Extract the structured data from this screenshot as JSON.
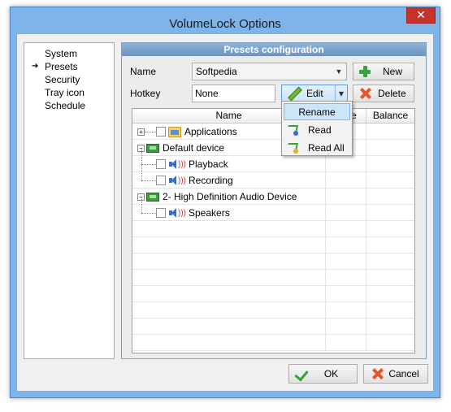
{
  "window": {
    "title": "VolumeLock Options",
    "close_label": "✕"
  },
  "nav": {
    "items": [
      {
        "label": "System",
        "selected": false
      },
      {
        "label": "Presets",
        "selected": true
      },
      {
        "label": "Security",
        "selected": false
      },
      {
        "label": "Tray icon",
        "selected": false
      },
      {
        "label": "Schedule",
        "selected": false
      }
    ]
  },
  "presets": {
    "header": "Presets configuration",
    "name_label": "Name",
    "name_value": "Softpedia",
    "hotkey_label": "Hotkey",
    "hotkey_value": "None",
    "new_label": "New",
    "edit_label": "Edit",
    "delete_label": "Delete"
  },
  "grid": {
    "columns": [
      "Name",
      "Mute",
      "Balance"
    ],
    "rows": [
      {
        "label": "Applications",
        "type": "group",
        "expander": "+"
      },
      {
        "label": "Default device",
        "type": "device",
        "expander": "−"
      },
      {
        "label": "Playback",
        "type": "channel"
      },
      {
        "label": "Recording",
        "type": "channel"
      },
      {
        "label": "2- High Definition Audio Device",
        "type": "device",
        "expander": "−"
      },
      {
        "label": "Speakers",
        "type": "channel"
      }
    ]
  },
  "edit_menu": {
    "items": [
      "Rename",
      "Read",
      "Read All"
    ]
  },
  "footer": {
    "ok_label": "OK",
    "cancel_label": "Cancel"
  },
  "colors": {
    "frame": "#7eb4ea",
    "panel_header": "#7aa0c8",
    "close_button": "#c7332b",
    "accent_green": "#3aa03a",
    "accent_red": "#e8542a"
  }
}
